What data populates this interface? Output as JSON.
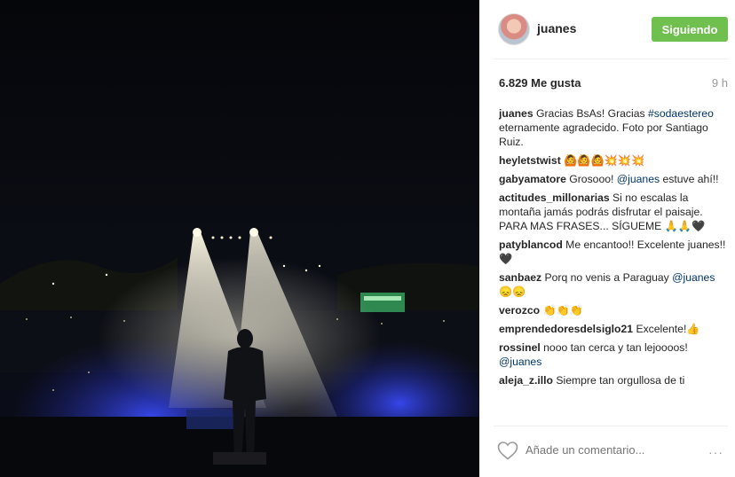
{
  "post": {
    "author": "juanes",
    "follow_label": "Siguiendo",
    "likes": "6.829 Me gusta",
    "time": "9 h"
  },
  "comments": [
    {
      "user": "juanes",
      "parts": [
        {
          "t": "Gracias BsAs! Gracias ",
          "link": false
        },
        {
          "t": "#sodaestereo",
          "link": true
        },
        {
          "t": " eternamente agradecido. Foto por Santiago Ruiz.",
          "link": false
        }
      ]
    },
    {
      "user": "heyletstwist",
      "parts": [
        {
          "t": "🙆🙆🙆💥💥💥",
          "link": false
        }
      ]
    },
    {
      "user": "gabyamatore",
      "parts": [
        {
          "t": "Grosooo! ",
          "link": false
        },
        {
          "t": "@juanes",
          "link": true
        },
        {
          "t": " estuve ahí!!",
          "link": false
        }
      ]
    },
    {
      "user": "actitudes_millonarias",
      "parts": [
        {
          "t": "Si no escalas la montaña jamás podrás disfrutar el paisaje. PARA MAS FRASES... SÍGUEME 🙏🙏🖤",
          "link": false
        }
      ]
    },
    {
      "user": "patyblancod",
      "parts": [
        {
          "t": "Me encantoo!! Excelente juanes!! 🖤",
          "link": false
        }
      ]
    },
    {
      "user": "sanbaez",
      "parts": [
        {
          "t": "Porq no venis a Paraguay ",
          "link": false
        },
        {
          "t": "@juanes",
          "link": true
        },
        {
          "t": " 😞😞",
          "link": false
        }
      ]
    },
    {
      "user": "verozco",
      "parts": [
        {
          "t": "👏👏👏",
          "link": false
        }
      ]
    },
    {
      "user": "emprendedoresdelsiglo21",
      "parts": [
        {
          "t": "Excelente!👍",
          "link": false
        }
      ]
    },
    {
      "user": "rossinel",
      "parts": [
        {
          "t": "nooo tan cerca y tan lejoooos! ",
          "link": false
        },
        {
          "t": "@juanes",
          "link": true
        }
      ]
    },
    {
      "user": "aleja_z.illo",
      "parts": [
        {
          "t": "Siempre tan orgullosa de ti",
          "link": false
        }
      ]
    }
  ],
  "footer": {
    "comment_placeholder": "Añade un comentario...",
    "more_label": "···"
  },
  "icons": {
    "heart": "heart-icon",
    "avatar": "avatar"
  },
  "colors": {
    "follow_bg": "#70c050",
    "link": "#003569",
    "muted": "#999999"
  }
}
